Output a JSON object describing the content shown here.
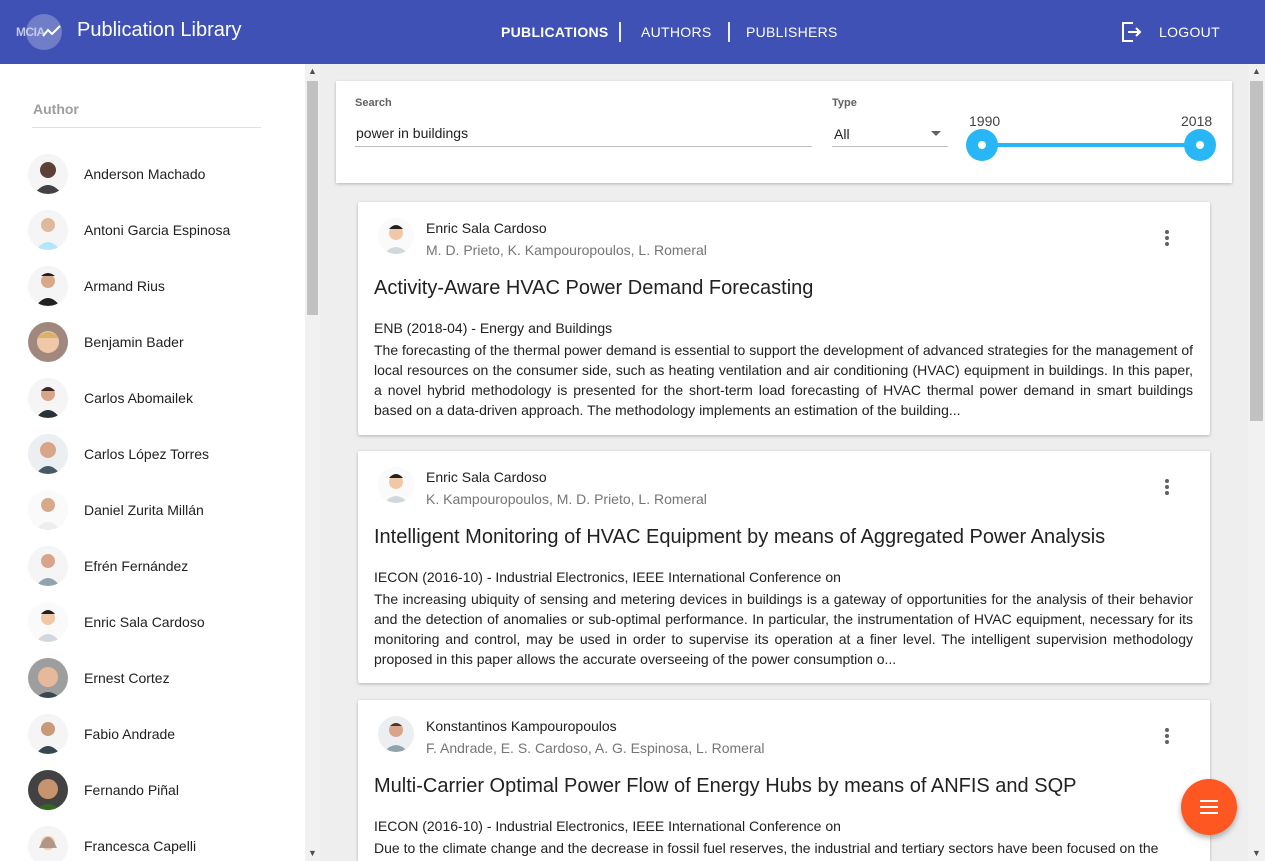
{
  "app": {
    "logo_text": "MCIA",
    "title": "Publication Library"
  },
  "nav": {
    "items": [
      "PUBLICATIONS",
      "AUTHORS",
      "PUBLISHERS"
    ],
    "active": "PUBLICATIONS",
    "logout_label": "LOGOUT"
  },
  "colors": {
    "primary": "#3f51b5",
    "accent": "#29b6f6",
    "fab": "#ff5722",
    "background": "#eeeeee"
  },
  "sidebar": {
    "header": "Author",
    "authors": [
      "Anderson Machado",
      "Antoni Garcia Espinosa",
      "Armand Rius",
      "Benjamin Bader",
      "Carlos Abomailek",
      "Carlos López Torres",
      "Daniel Zurita Millán",
      "Efrén Fernández",
      "Enric Sala Cardoso",
      "Ernest Cortez",
      "Fabio Andrade",
      "Fernando Piñal",
      "Francesca Capelli"
    ]
  },
  "filters": {
    "search_label": "Search",
    "search_value": "power in buildings",
    "type_label": "Type",
    "type_value": "All",
    "year_min": "1990",
    "year_max": "2018"
  },
  "publications": [
    {
      "author": "Enric Sala Cardoso",
      "coauthors": "M. D. Prieto, K. Kampouropoulos, L. Romeral",
      "title": "Activity-Aware HVAC Power Demand Forecasting",
      "venue": "ENB (2018-04) - Energy and Buildings",
      "abstract": "The forecasting of the thermal power demand is essential to support the development of advanced strategies for the management of local resources on the consumer side, such as heating ventilation and air conditioning (HVAC) equipment in buildings. In this paper, a novel hybrid methodology is presented for the short-term load forecasting of HVAC thermal power demand in smart buildings based on a data-driven approach. The methodology implements an estimation of the building..."
    },
    {
      "author": "Enric Sala Cardoso",
      "coauthors": "K. Kampouropoulos, M. D. Prieto, L. Romeral",
      "title": "Intelligent Monitoring of HVAC Equipment by means of Aggregated Power Analysis",
      "venue": "IECON (2016-10) - Industrial Electronics, IEEE International Conference on",
      "abstract": "The increasing ubiquity of sensing and metering devices in buildings is a gateway of opportunities for the analysis of their behavior and the detection of anomalies or sub-optimal performance. In particular, the instrumentation of HVAC equipment, necessary for its monitoring and control, may be used in order to supervise its operation at a finer level. The intelligent supervision methodology proposed in this paper allows the accurate overseeing of the power consumption o..."
    },
    {
      "author": "Konstantinos Kampouropoulos",
      "coauthors": "F. Andrade, E. S. Cardoso, A. G. Espinosa, L. Romeral",
      "title": "Multi-Carrier Optimal Power Flow of Energy Hubs by means of ANFIS and SQP",
      "venue": "IECON (2016-10) - Industrial Electronics, IEEE International Conference on",
      "abstract": "Due to the climate change and the decrease in fossil fuel reserves, the industrial and tertiary sectors have been focused on the"
    }
  ]
}
